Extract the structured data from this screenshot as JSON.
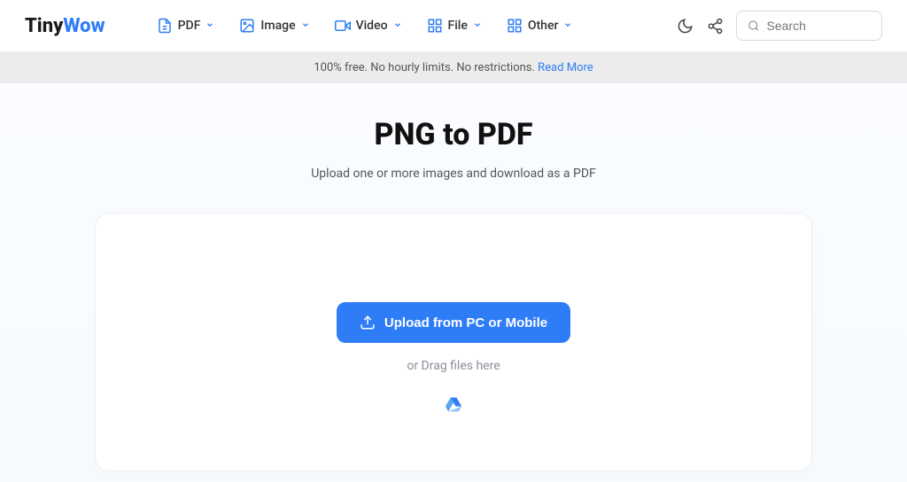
{
  "logo": {
    "part1": "Tiny",
    "part2": "Wow"
  },
  "nav": {
    "items": [
      {
        "label": "PDF"
      },
      {
        "label": "Image"
      },
      {
        "label": "Video"
      },
      {
        "label": "File"
      },
      {
        "label": "Other"
      }
    ]
  },
  "search": {
    "placeholder": "Search"
  },
  "banner": {
    "text": "100% free. No hourly limits. No restrictions. ",
    "link": "Read More"
  },
  "page": {
    "title": "PNG to PDF",
    "subtitle": "Upload one or more images and download as a PDF"
  },
  "upload": {
    "button": "Upload from PC or Mobile",
    "drag_text": "or Drag files here"
  }
}
